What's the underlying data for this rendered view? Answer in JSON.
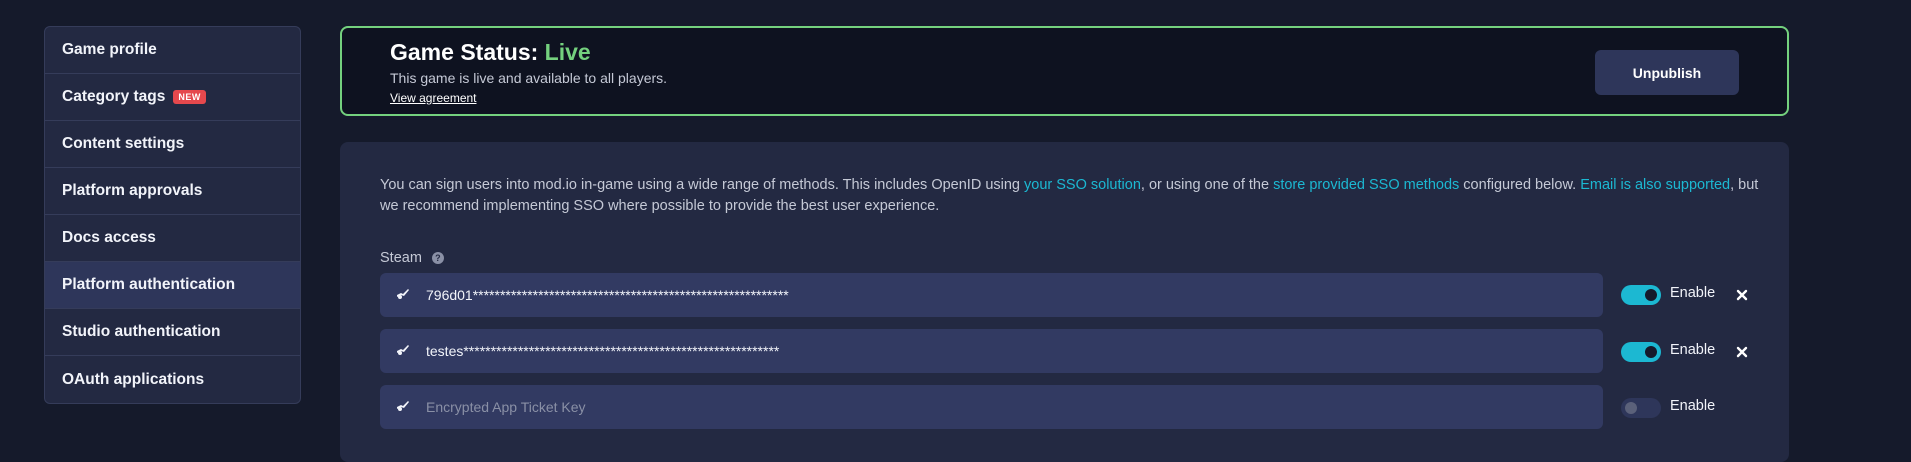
{
  "sidebar": {
    "items": [
      {
        "label": "Game profile"
      },
      {
        "label": "Category tags",
        "badge": "NEW"
      },
      {
        "label": "Content settings"
      },
      {
        "label": "Platform approvals"
      },
      {
        "label": "Docs access"
      },
      {
        "label": "Platform authentication",
        "active": true
      },
      {
        "label": "Studio authentication"
      },
      {
        "label": "OAuth applications"
      }
    ]
  },
  "status": {
    "title_prefix": "Game Status: ",
    "title_state": "Live",
    "description": "This game is live and available to all players.",
    "link": "View agreement",
    "button": "Unpublish"
  },
  "intro": {
    "text1": "You can sign users into mod.io in-game using a wide range of methods. This includes OpenID using ",
    "link1": "your SSO solution",
    "text2": ", or using one of the ",
    "link2": "store provided SSO methods",
    "text3": " configured below. ",
    "link3": "Email is also supported",
    "text4": ", but we recommend implementing SSO where possible to provide the best user experience."
  },
  "steam": {
    "label": "Steam",
    "help_icon": "question-circle-icon",
    "rows": [
      {
        "value": "796d01**********************************************************",
        "enabled": true,
        "enable_label": "Enable",
        "removable": true
      },
      {
        "value": "testes**********************************************************",
        "enabled": true,
        "enable_label": "Enable",
        "removable": true
      },
      {
        "value": "",
        "placeholder": "Encrypted App Ticket Key",
        "enabled": false,
        "enable_label": "Enable",
        "removable": false
      }
    ]
  },
  "colors": {
    "accent": "#1cb8d2",
    "live": "#74d17e",
    "badge": "#e5484d",
    "background": "#151a2b",
    "panel": "#232942"
  }
}
